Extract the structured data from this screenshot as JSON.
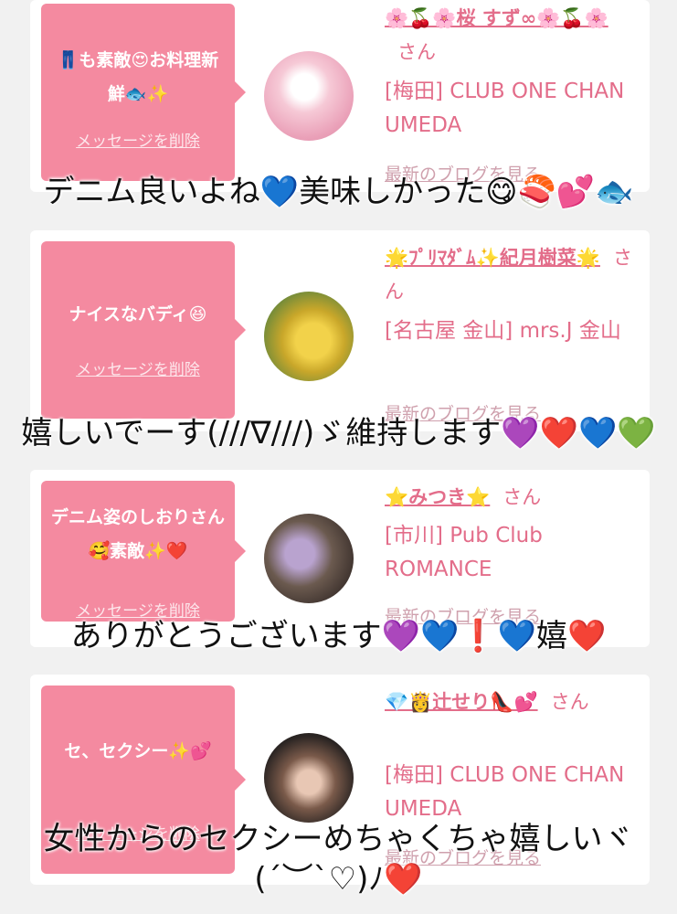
{
  "messages": [
    {
      "bubble_text": "👖も素敵😍お料理新鮮🐟✨",
      "delete_label": "メッセージを削除",
      "name": "🌸🍒🌸桜 すず∞🌸🍒🌸",
      "san": "さん",
      "shop": "[梅田] CLUB ONE CHAN UMEDA",
      "blog_link": "最新のブログを見る",
      "reply": "デニム良いよね💙美味しかった😋🍣💕🐟"
    },
    {
      "bubble_text": "ナイスなバディ😆",
      "delete_label": "メッセージを削除",
      "name": "🌟ﾌﾟﾘﾏﾀﾞﾑ✨紀月樹菜🌟",
      "san": "さん",
      "shop": "[名古屋 金山] mrs.J 金山",
      "blog_link": "最新のブログを見る",
      "reply": "嬉しいでーす(///∇///)ゞ維持します💜❤️💙💚"
    },
    {
      "bubble_text": "デニム姿のしおりさん🥰素敵✨❤️",
      "delete_label": "メッセージを削除",
      "name": "⭐️みつき⭐️",
      "san": "さん",
      "shop": "[市川] Pub Club ROMANCE",
      "blog_link": "最新のブログを見る",
      "reply": "ありがとうございます💜💙❗️💙嬉❤️"
    },
    {
      "bubble_text": "セ、セクシー✨💕",
      "delete_label": "メッセージを削除",
      "name": "💎👸辻せり👠💕",
      "san": "さん",
      "shop": "[梅田] CLUB ONE CHAN UMEDA",
      "blog_link": "最新のブログを見る",
      "reply": "女性からのセクシーめちゃくちゃ嬉しいヾ(´︶`♡)ﾉ❤️"
    }
  ]
}
